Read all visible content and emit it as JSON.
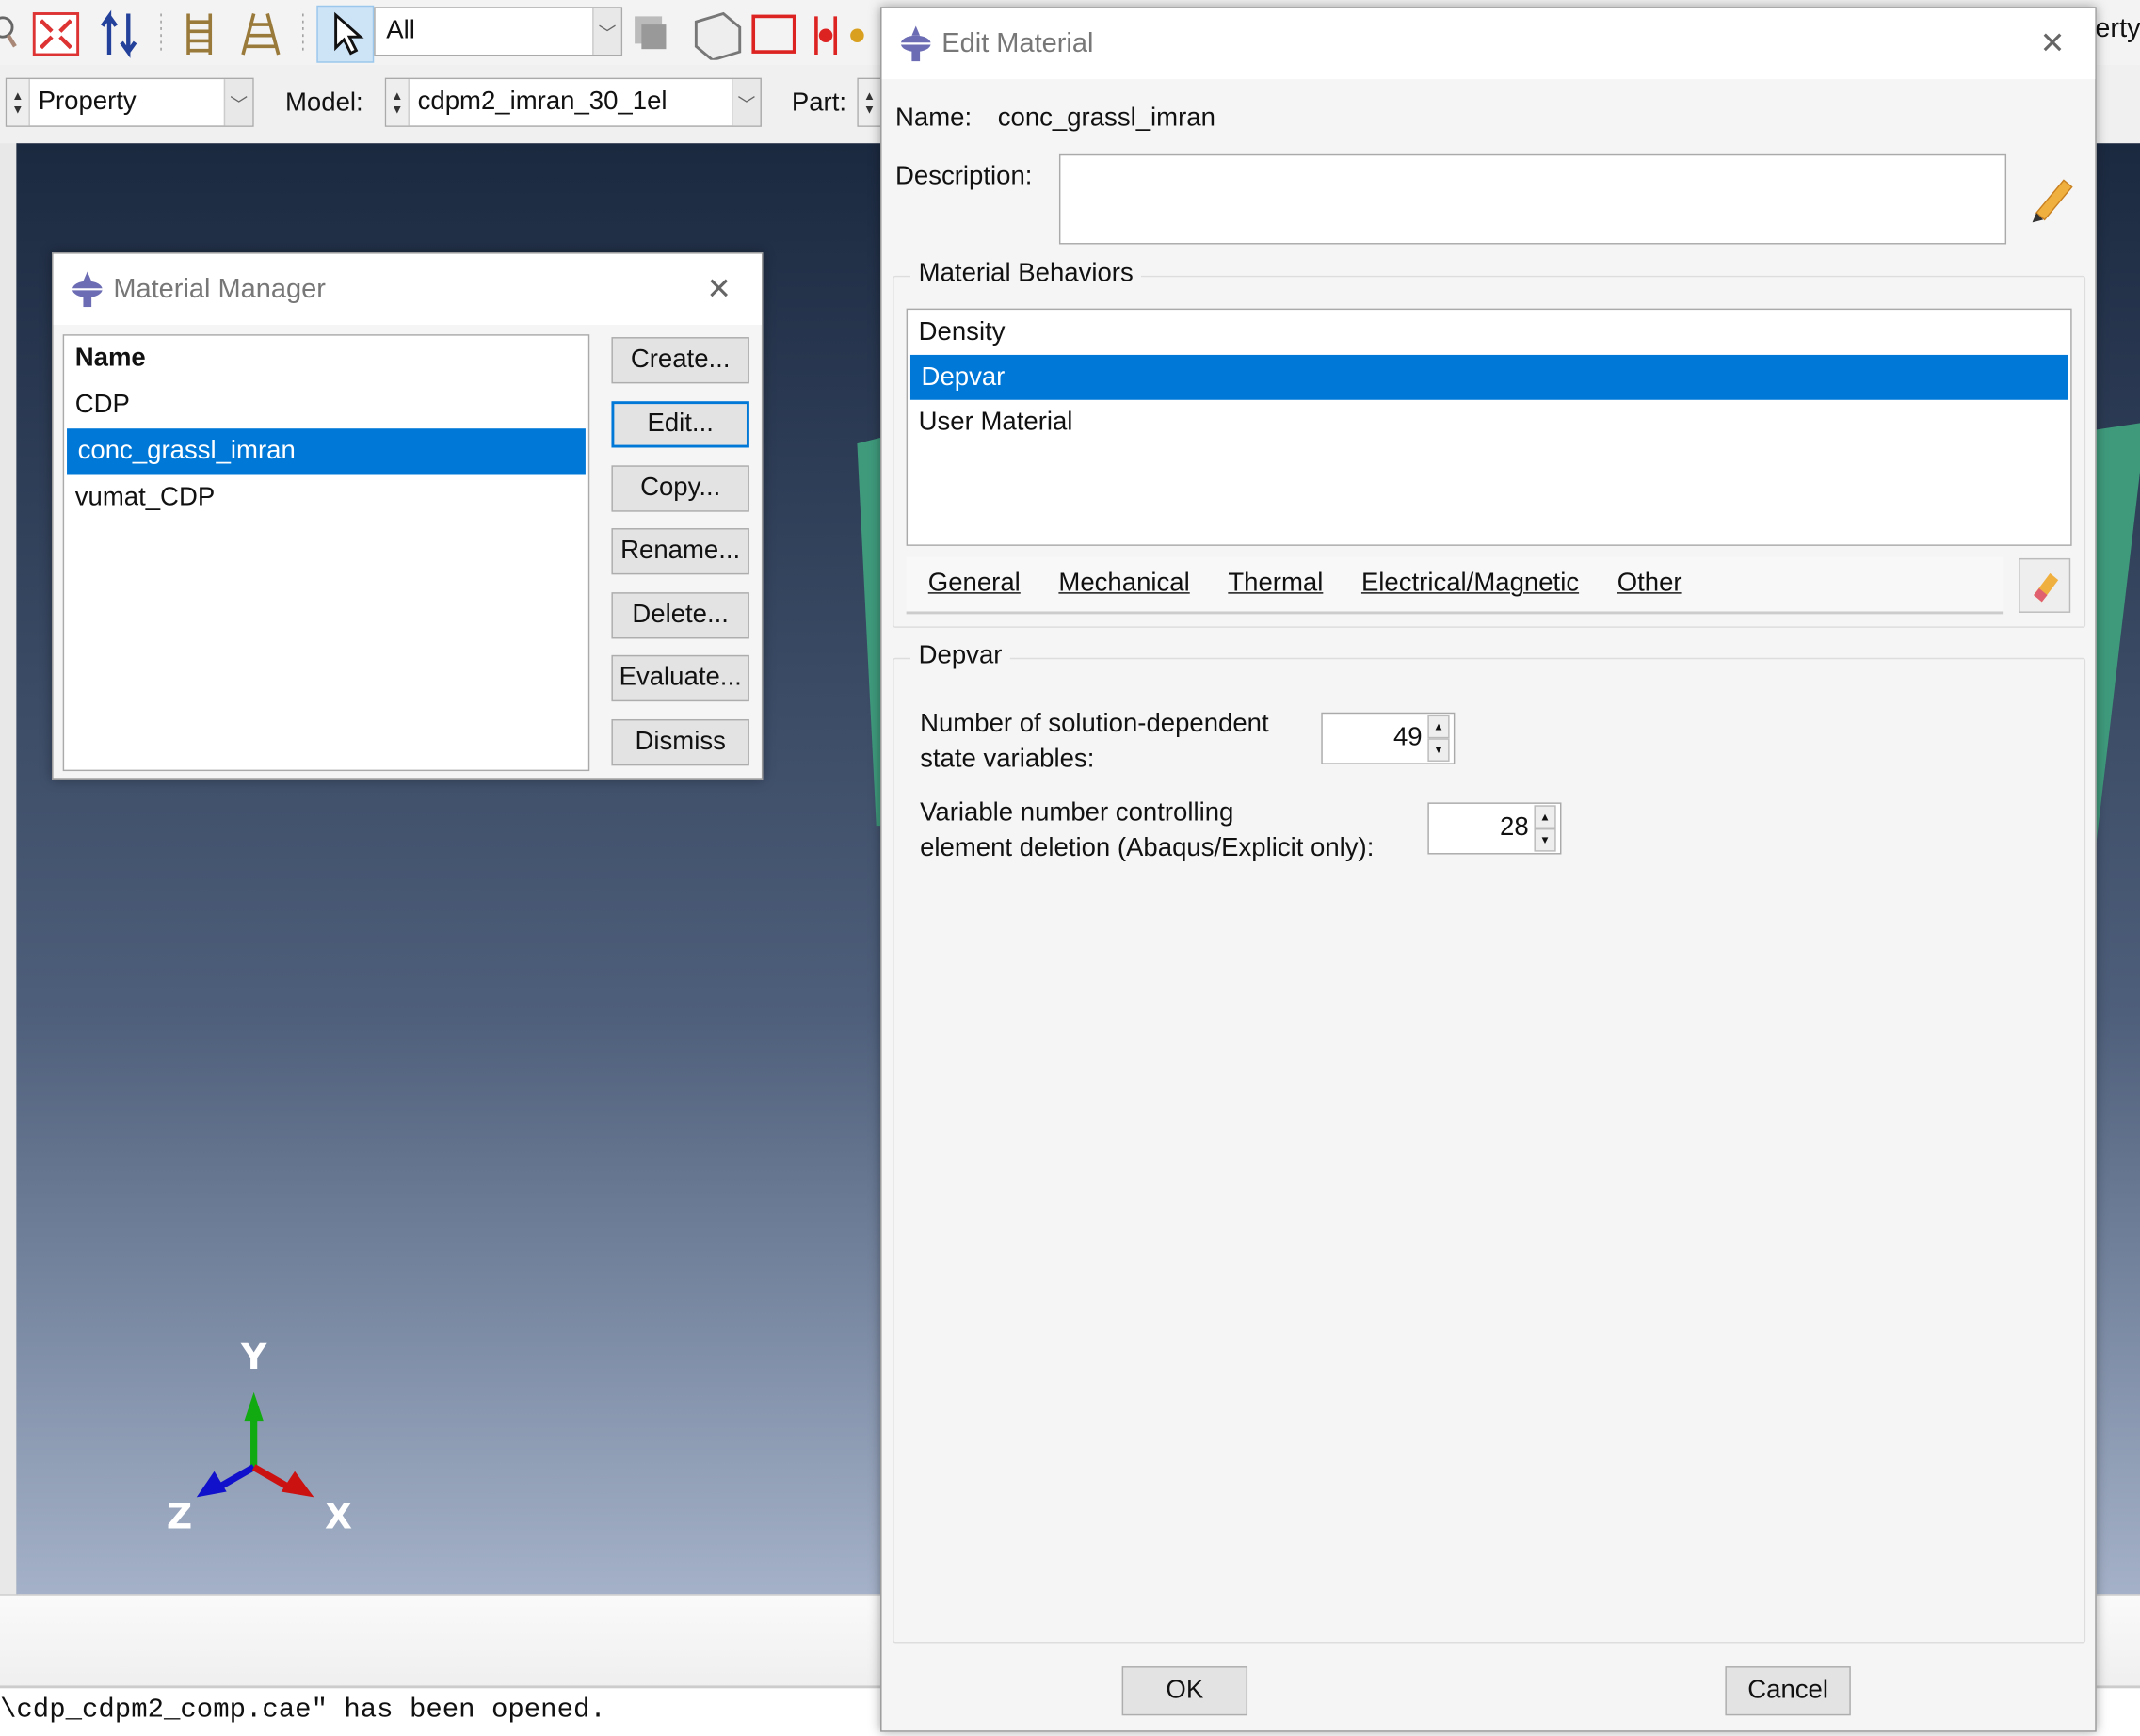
{
  "toolbar": {
    "selection_filter": "All",
    "module_label": "",
    "module_value": "Property",
    "model_label": "Model:",
    "model_value": "cdpm2_imran_30_1el",
    "part_label": "Part:",
    "right_partial_text": "erty",
    "icons": [
      "zoom-icon",
      "auto-fit-icon",
      "swap-icon",
      "ladder-icon",
      "ladder-perspective-icon",
      "select-arrow-icon",
      "render-icon",
      "box-icon",
      "select-box-icon",
      "constraint-icon"
    ]
  },
  "viewport": {
    "triad": {
      "x": "X",
      "y": "Y",
      "z": "Z"
    },
    "colors": {
      "x": "#cc1111",
      "y": "#11aa11",
      "z": "#1111cc",
      "object": "#3f9a7c"
    }
  },
  "message_area": {
    "text": "\\cdp_cdpm2_comp.cae\" has been opened."
  },
  "material_manager": {
    "title": "Material Manager",
    "column_header": "Name",
    "items": [
      "CDP",
      "conc_grassl_imran",
      "vumat_CDP"
    ],
    "selected": "conc_grassl_imran",
    "buttons": [
      "Create...",
      "Edit...",
      "Copy...",
      "Rename...",
      "Delete...",
      "Evaluate...",
      "Dismiss"
    ]
  },
  "edit_material": {
    "title": "Edit Material",
    "name_label": "Name:",
    "name_value": "conc_grassl_imran",
    "description_label": "Description:",
    "description_value": "",
    "behaviors_label": "Material Behaviors",
    "behaviors": [
      "Density",
      "Depvar",
      "User Material"
    ],
    "selected_behavior": "Depvar",
    "tabs": [
      "General",
      "Mechanical",
      "Thermal",
      "Electrical/Magnetic",
      "Other"
    ],
    "section_label": "Depvar",
    "field1_label_line1": "Number of solution-dependent",
    "field1_label_line2": "state variables:",
    "field1_value": "49",
    "field2_label_line1": "Variable number controlling",
    "field2_label_line2": "element deletion (Abaqus/Explicit only):",
    "field2_value": "28",
    "ok_label": "OK",
    "cancel_label": "Cancel",
    "accent": "#0078d7"
  }
}
